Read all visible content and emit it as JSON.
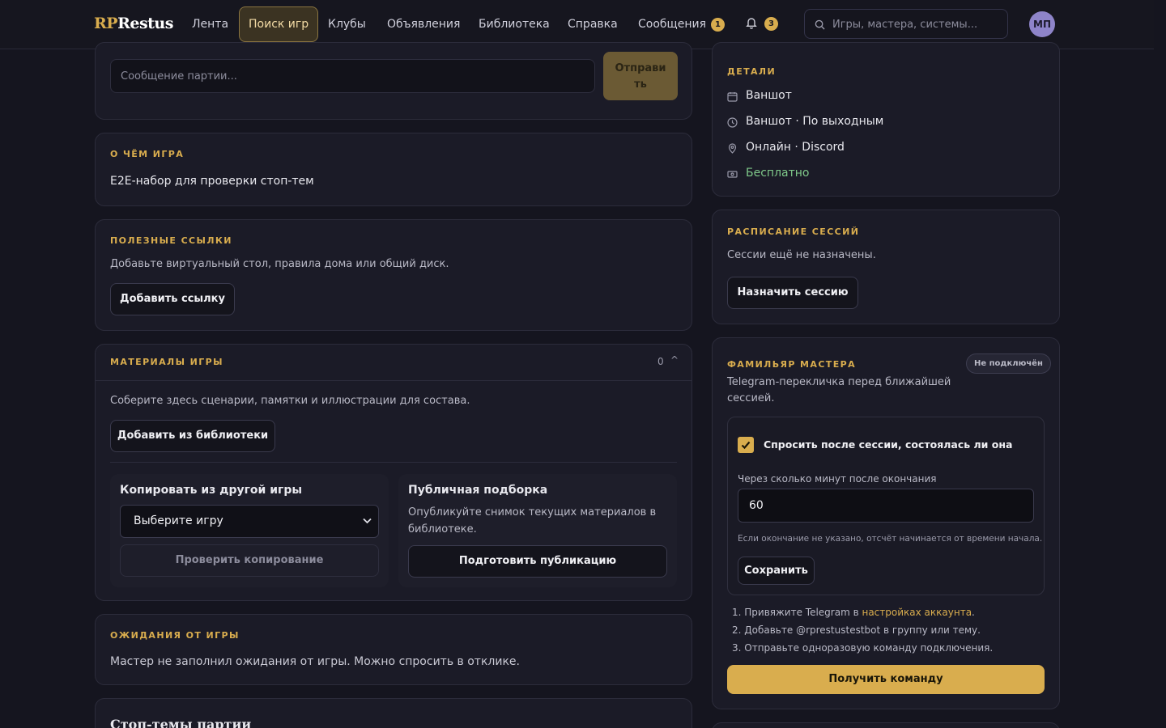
{
  "nav": {
    "logo_prefix": "RP",
    "logo_suffix": "Restus",
    "items": [
      {
        "label": "Лента"
      },
      {
        "label": "Поиск игр"
      },
      {
        "label": "Клубы"
      },
      {
        "label": "Объявления"
      },
      {
        "label": "Библиотека"
      },
      {
        "label": "Справка"
      },
      {
        "label": "Сообщения"
      }
    ],
    "messages_badge": "1",
    "notifications_badge": "3",
    "search_placeholder": "Игры, мастера, системы...",
    "avatar_initials": "МП"
  },
  "chat": {
    "input_placeholder": "Сообщение партии...",
    "send_label": "Отправить"
  },
  "about": {
    "title": "О чём игра",
    "text": "E2E-набор для проверки стоп-тем"
  },
  "links": {
    "title": "Полезные ссылки",
    "text": "Добавьте виртуальный стол, правила дома или общий диск.",
    "add_button": "Добавить ссылку"
  },
  "materials": {
    "title": "Материалы игры",
    "count": "0",
    "collapse_glyph": "^",
    "text": "Соберите здесь сценарии, памятки и иллюстрации для состава.",
    "add_button": "Добавить из библиотеки",
    "copy": {
      "title": "Копировать из другой игры",
      "select_value": "Выберите игру",
      "check_button": "Проверить копирование"
    },
    "public": {
      "title": "Публичная подборка",
      "text_line1": "Опубликуйте снимок текущих материалов в",
      "text_line2": "библиотеке.",
      "button": "Подготовить публикацию"
    }
  },
  "expectations": {
    "title": "Ожидания от игры",
    "text": "Мастер не заполнил ожидания от игры. Можно спросить в отклике."
  },
  "stop_topics": {
    "title": "Стоп-темы партии"
  },
  "details": {
    "title": "Детали",
    "format": "Ваншот",
    "schedule": "Ваншот · По выходным",
    "location": "Онлайн · Discord",
    "price": "Бесплатно",
    "price_color": "#7fc98a"
  },
  "sessions": {
    "title": "Расписание сессий",
    "text": "Сессии ещё не назначены.",
    "button": "Назначить сессию"
  },
  "familiar": {
    "title": "Фамильяр мастера",
    "status": "Не подключён",
    "desc_line1": "Telegram-перекличка перед ближайшей",
    "desc_line2": "сессией.",
    "checkbox_label": "Спросить после сессии, состоялась ли она",
    "checkbox_checked": true,
    "minutes_label": "Через сколько минут после окончания",
    "minutes_value": "60",
    "hint": "Если окончание не указано, отсчёт начинается от времени начала.",
    "save_button": "Сохранить",
    "step1_prefix": "1. Привяжите Telegram в ",
    "step1_link": "настройках аккаунта",
    "step1_suffix": ".",
    "step2": "2. Добавьте @rprestustestbot в группу или тему.",
    "step3": "3. Отправьте одноразовую команду подключения.",
    "get_command_button": "Получить команду"
  },
  "colors": {
    "accent": "#d9ad4e",
    "background": "#15151f",
    "card": "#1b1b27"
  }
}
